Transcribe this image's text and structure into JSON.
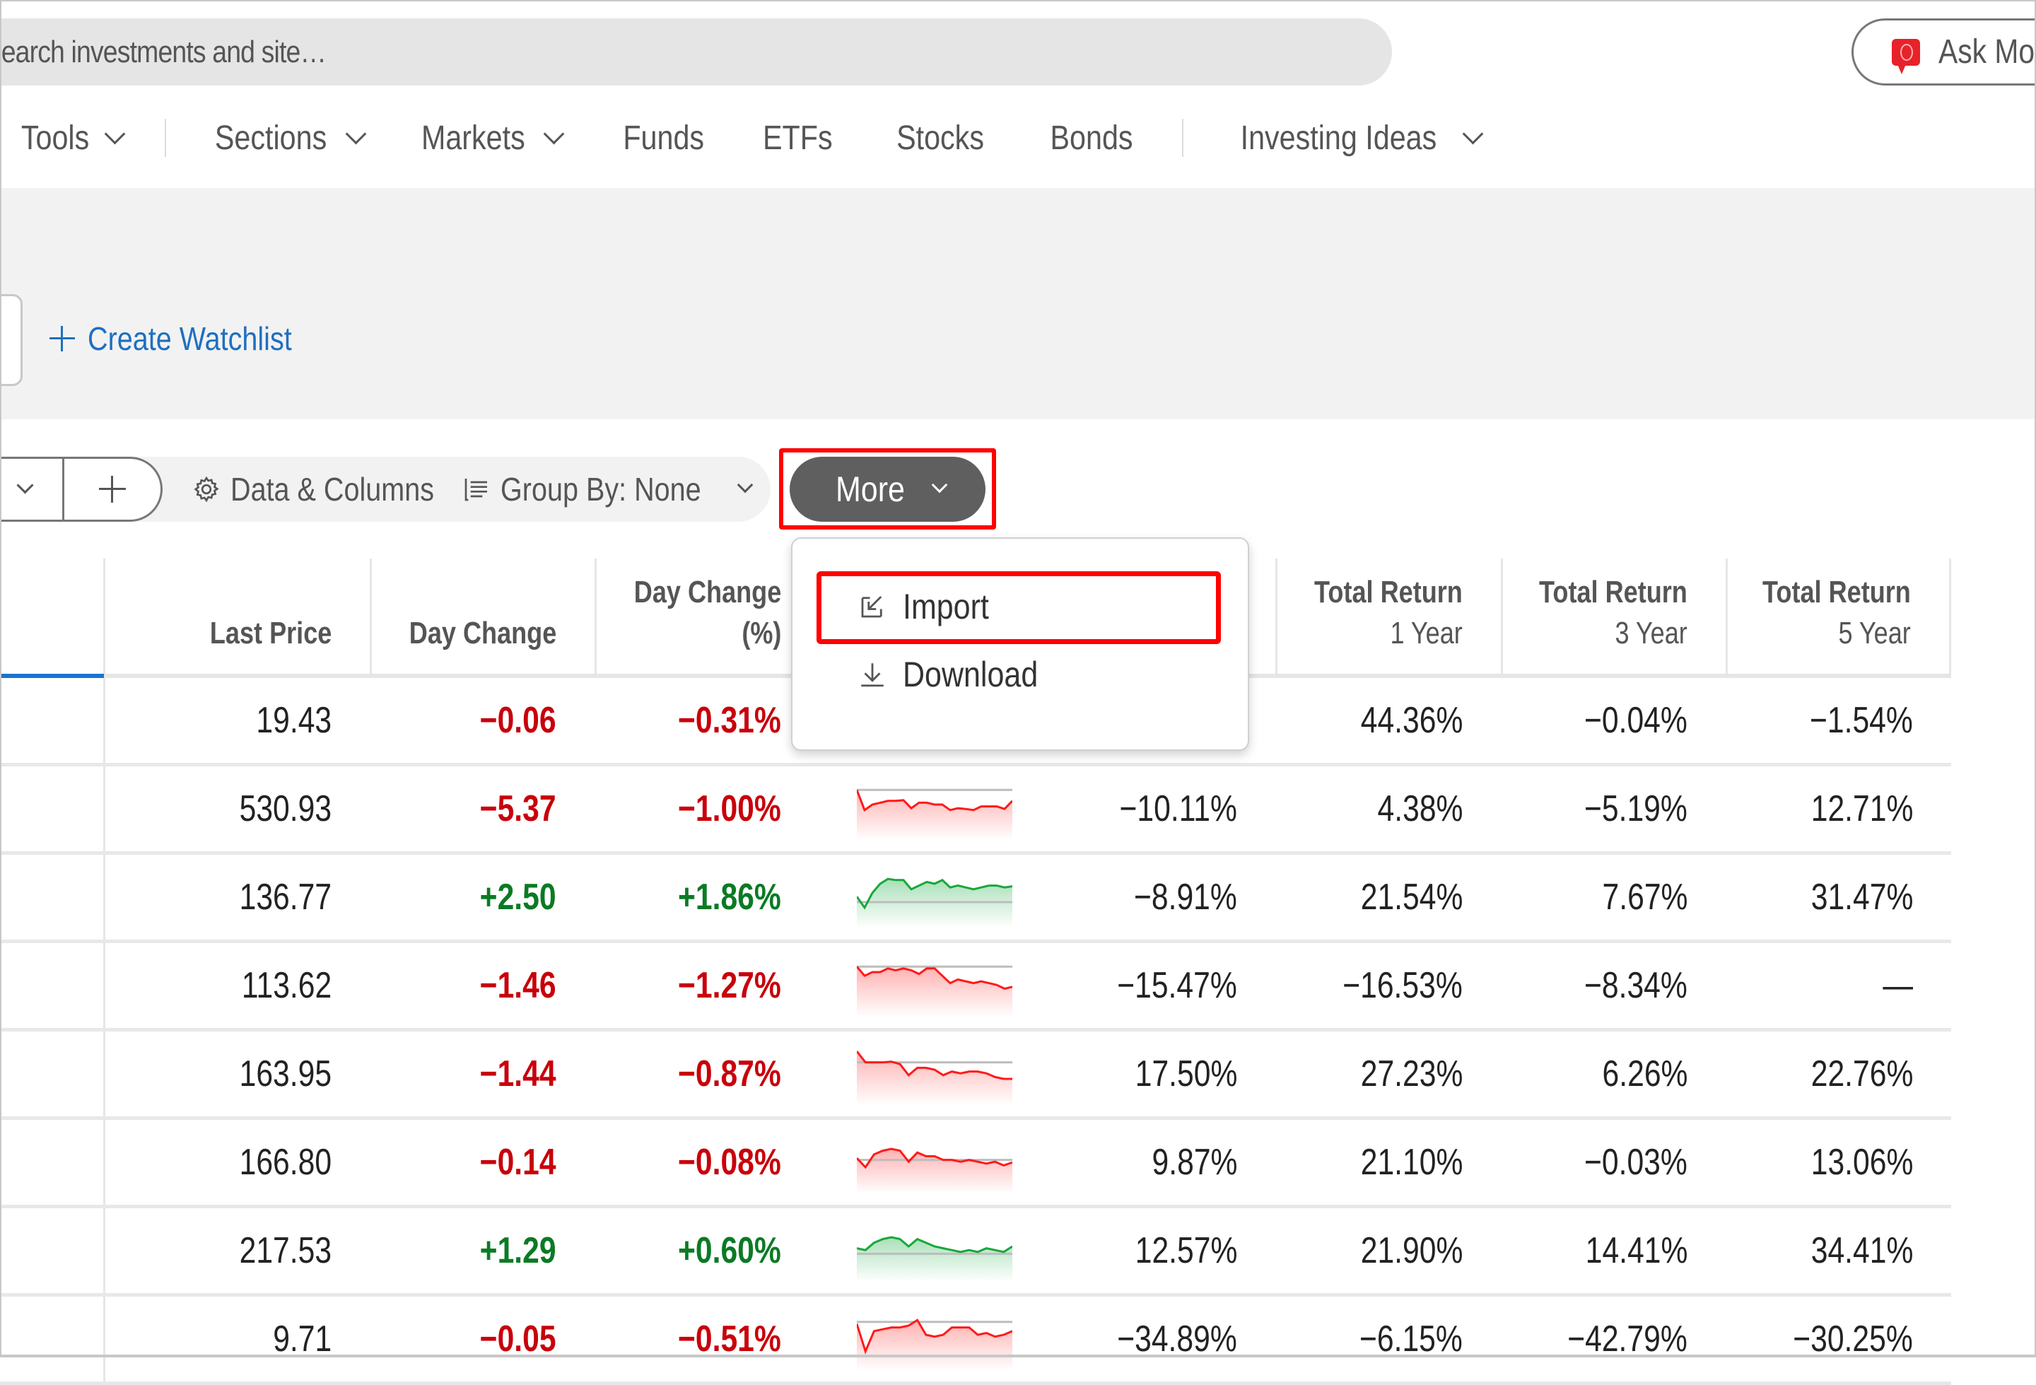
{
  "header": {
    "search": {
      "placeholder": "Search investments and site…",
      "visible_text": "earch investments and site…"
    },
    "ask_button": {
      "label": "Ask Mo",
      "icon": "chat-bubble-icon",
      "icon_color": "#e8222a"
    }
  },
  "nav": {
    "items": [
      {
        "label": "Tools",
        "has_dropdown": true
      },
      {
        "label": "Sections",
        "has_dropdown": true
      },
      {
        "label": "Markets",
        "has_dropdown": true
      },
      {
        "label": "Funds",
        "has_dropdown": false
      },
      {
        "label": "ETFs",
        "has_dropdown": false
      },
      {
        "label": "Stocks",
        "has_dropdown": false
      },
      {
        "label": "Bonds",
        "has_dropdown": false
      },
      {
        "label": "Investing Ideas",
        "has_dropdown": true
      }
    ]
  },
  "watchlist": {
    "create_label": "Create Watchlist",
    "accent_color": "#1f6fbf"
  },
  "toolbar": {
    "data_columns_label": "Data & Columns",
    "group_by_label": "Group By: None",
    "more_label": "More",
    "highlight_color": "#ff0000"
  },
  "more_menu": {
    "items": [
      {
        "label": "Import",
        "icon": "import-icon",
        "highlighted": true
      },
      {
        "label": "Download",
        "icon": "download-icon",
        "highlighted": false
      }
    ]
  },
  "table": {
    "columns": [
      {
        "title": "Last Price",
        "subtitle": ""
      },
      {
        "title": "Day Change",
        "subtitle": ""
      },
      {
        "title": "Day Change",
        "subtitle": "(%)"
      },
      {
        "title": "",
        "subtitle": ""
      },
      {
        "title": "",
        "subtitle": ""
      },
      {
        "title": "Total Return",
        "subtitle": "1 Year"
      },
      {
        "title": "Total Return",
        "subtitle": "3 Year"
      },
      {
        "title": "Total Return",
        "subtitle": "5 Year"
      }
    ],
    "colors": {
      "negative": "#c8000a",
      "positive": "#0b7a24",
      "spark_neg": "#ff1a1a",
      "spark_pos": "#16a83a"
    },
    "rows": [
      {
        "last_price": "19.43",
        "day_change": "−0.06",
        "day_change_pct": "−0.31%",
        "trend": "neg",
        "ytd": "",
        "tr_1y": "44.36%",
        "tr_3y": "−0.04%",
        "tr_5y": "−1.54%"
      },
      {
        "last_price": "530.93",
        "day_change": "−5.37",
        "day_change_pct": "−1.00%",
        "trend": "neg",
        "ytd": "−10.11%",
        "tr_1y": "4.38%",
        "tr_3y": "−5.19%",
        "tr_5y": "12.71%"
      },
      {
        "last_price": "136.77",
        "day_change": "+2.50",
        "day_change_pct": "+1.86%",
        "trend": "pos",
        "ytd": "−8.91%",
        "tr_1y": "21.54%",
        "tr_3y": "7.67%",
        "tr_5y": "31.47%"
      },
      {
        "last_price": "113.62",
        "day_change": "−1.46",
        "day_change_pct": "−1.27%",
        "trend": "neg",
        "ytd": "−15.47%",
        "tr_1y": "−16.53%",
        "tr_3y": "−8.34%",
        "tr_5y": "—"
      },
      {
        "last_price": "163.95",
        "day_change": "−1.44",
        "day_change_pct": "−0.87%",
        "trend": "neg",
        "ytd": "17.50%",
        "tr_1y": "27.23%",
        "tr_3y": "6.26%",
        "tr_5y": "22.76%"
      },
      {
        "last_price": "166.80",
        "day_change": "−0.14",
        "day_change_pct": "−0.08%",
        "trend": "neg",
        "ytd": "9.87%",
        "tr_1y": "21.10%",
        "tr_3y": "−0.03%",
        "tr_5y": "13.06%"
      },
      {
        "last_price": "217.53",
        "day_change": "+1.29",
        "day_change_pct": "+0.60%",
        "trend": "pos",
        "ytd": "12.57%",
        "tr_1y": "21.90%",
        "tr_3y": "14.41%",
        "tr_5y": "34.41%"
      },
      {
        "last_price": "9.71",
        "day_change": "−0.05",
        "day_change_pct": "−0.51%",
        "trend": "neg",
        "ytd": "−34.89%",
        "tr_1y": "−6.15%",
        "tr_3y": "−42.79%",
        "tr_5y": "−30.25%"
      }
    ],
    "sparklines": [
      {
        "baseline": 0.1,
        "points": [
          0.6,
          0.7,
          0.65,
          0.6,
          0.62,
          0.68,
          0.7,
          0.65,
          0.6,
          0.5,
          0.55,
          0.6,
          0.62,
          0.58,
          0.55,
          0.5,
          0.55,
          0.6,
          0.62,
          0.58
        ]
      },
      {
        "baseline": 0.1,
        "points": [
          0.1,
          0.65,
          0.5,
          0.45,
          0.4,
          0.4,
          0.38,
          0.6,
          0.45,
          0.45,
          0.5,
          0.5,
          0.65,
          0.6,
          0.62,
          0.65,
          0.55,
          0.55,
          0.55,
          0.62,
          0.4
        ]
      },
      {
        "baseline": 0.75,
        "points": [
          0.6,
          0.9,
          0.5,
          0.25,
          0.12,
          0.15,
          0.15,
          0.4,
          0.3,
          0.2,
          0.25,
          0.15,
          0.35,
          0.3,
          0.35,
          0.4,
          0.35,
          0.3,
          0.3,
          0.35,
          0.32
        ]
      },
      {
        "baseline": 0.1,
        "points": [
          0.1,
          0.35,
          0.25,
          0.25,
          0.15,
          0.2,
          0.15,
          0.2,
          0.3,
          0.15,
          0.15,
          0.35,
          0.55,
          0.45,
          0.5,
          0.55,
          0.5,
          0.55,
          0.6,
          0.7,
          0.65
        ]
      },
      {
        "baseline": 0.3,
        "points": [
          0.0,
          0.3,
          0.3,
          0.3,
          0.28,
          0.35,
          0.65,
          0.45,
          0.45,
          0.5,
          0.65,
          0.55,
          0.6,
          0.55,
          0.55,
          0.6,
          0.7,
          0.75,
          0.75
        ]
      },
      {
        "baseline": 0.55,
        "points": [
          0.5,
          0.75,
          0.4,
          0.3,
          0.25,
          0.3,
          0.6,
          0.35,
          0.45,
          0.45,
          0.55,
          0.55,
          0.6,
          0.55,
          0.6,
          0.65,
          0.6,
          0.7,
          0.62
        ]
      },
      {
        "baseline": 0.7,
        "points": [
          0.55,
          0.6,
          0.4,
          0.3,
          0.25,
          0.3,
          0.5,
          0.3,
          0.4,
          0.5,
          0.55,
          0.6,
          0.65,
          0.6,
          0.65,
          0.55,
          0.6,
          0.65,
          0.5
        ]
      },
      {
        "baseline": 0.15,
        "points": [
          0.2,
          0.95,
          0.4,
          0.35,
          0.3,
          0.3,
          0.25,
          0.1,
          0.5,
          0.55,
          0.5,
          0.3,
          0.3,
          0.3,
          0.5,
          0.45,
          0.55,
          0.5,
          0.4
        ]
      }
    ]
  }
}
